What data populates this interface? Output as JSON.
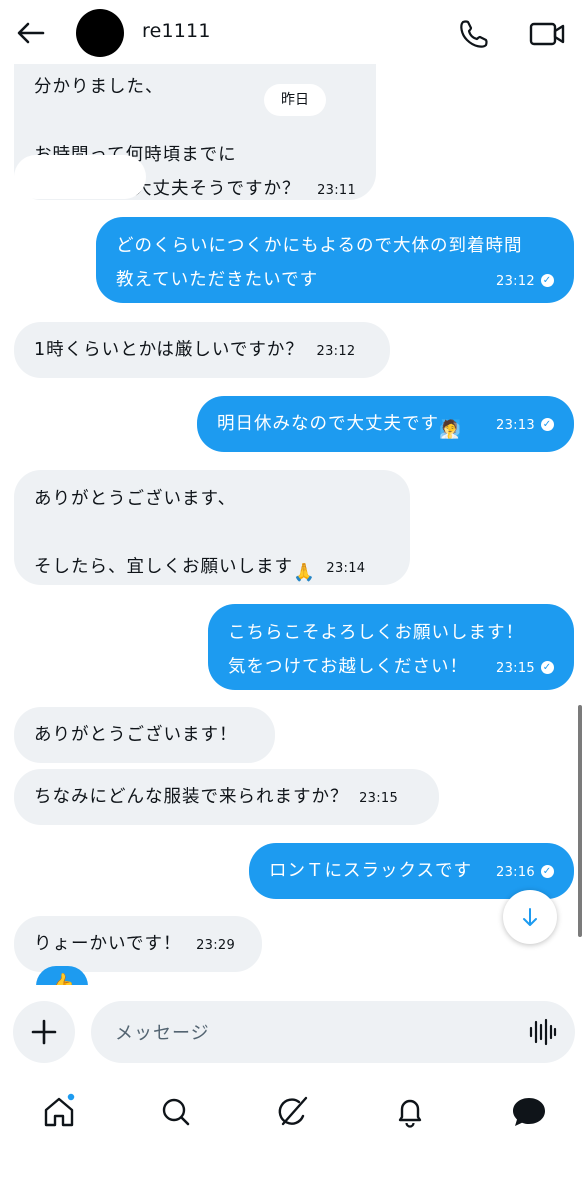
{
  "header": {
    "contact_name": "re1111"
  },
  "date_divider": "昨日",
  "messages": [
    {
      "dir": "in",
      "lines": [
        "分かりました、",
        "",
        "お時間って何時頃までに",
        "大丈夫そうですか？"
      ],
      "time": "23:11"
    },
    {
      "dir": "out",
      "lines": [
        "どのくらいにつくかにもよるので大体の到着時間",
        "教えていただきたいです"
      ],
      "time": "23:12"
    },
    {
      "dir": "in",
      "lines": [
        "1時くらいとかは厳しいですか？"
      ],
      "time": "23:12"
    },
    {
      "dir": "out",
      "lines": [
        "明日休みなので大丈夫です"
      ],
      "emoji": "🧖",
      "time": "23:13"
    },
    {
      "dir": "in",
      "lines": [
        "ありがとうございます、",
        "",
        "そしたら、宜しくお願いします"
      ],
      "emoji": "🙏",
      "time": "23:14"
    },
    {
      "dir": "out",
      "lines": [
        "こちらこそよろしくお願いします！",
        "気をつけてお越しください！"
      ],
      "time": "23:15"
    },
    {
      "dir": "in",
      "lines": [
        "ありがとうございます！"
      ],
      "time": ""
    },
    {
      "dir": "in",
      "lines": [
        "ちなみにどんな服装で来られますか？"
      ],
      "time": "23:15"
    },
    {
      "dir": "out",
      "lines": [
        "ロンＴにスラックスです"
      ],
      "time": "23:16"
    },
    {
      "dir": "in",
      "lines": [
        "りょーかいです！"
      ],
      "time": "23:29"
    }
  ],
  "reaction_emoji": "👍",
  "composer": {
    "placeholder": "メッセージ"
  },
  "bottom_nav": [
    "home",
    "search",
    "grok",
    "notifications",
    "messages"
  ],
  "colors": {
    "accent": "#1d9bf0",
    "incoming_bg": "#eef1f4",
    "text": "#0f1419"
  }
}
